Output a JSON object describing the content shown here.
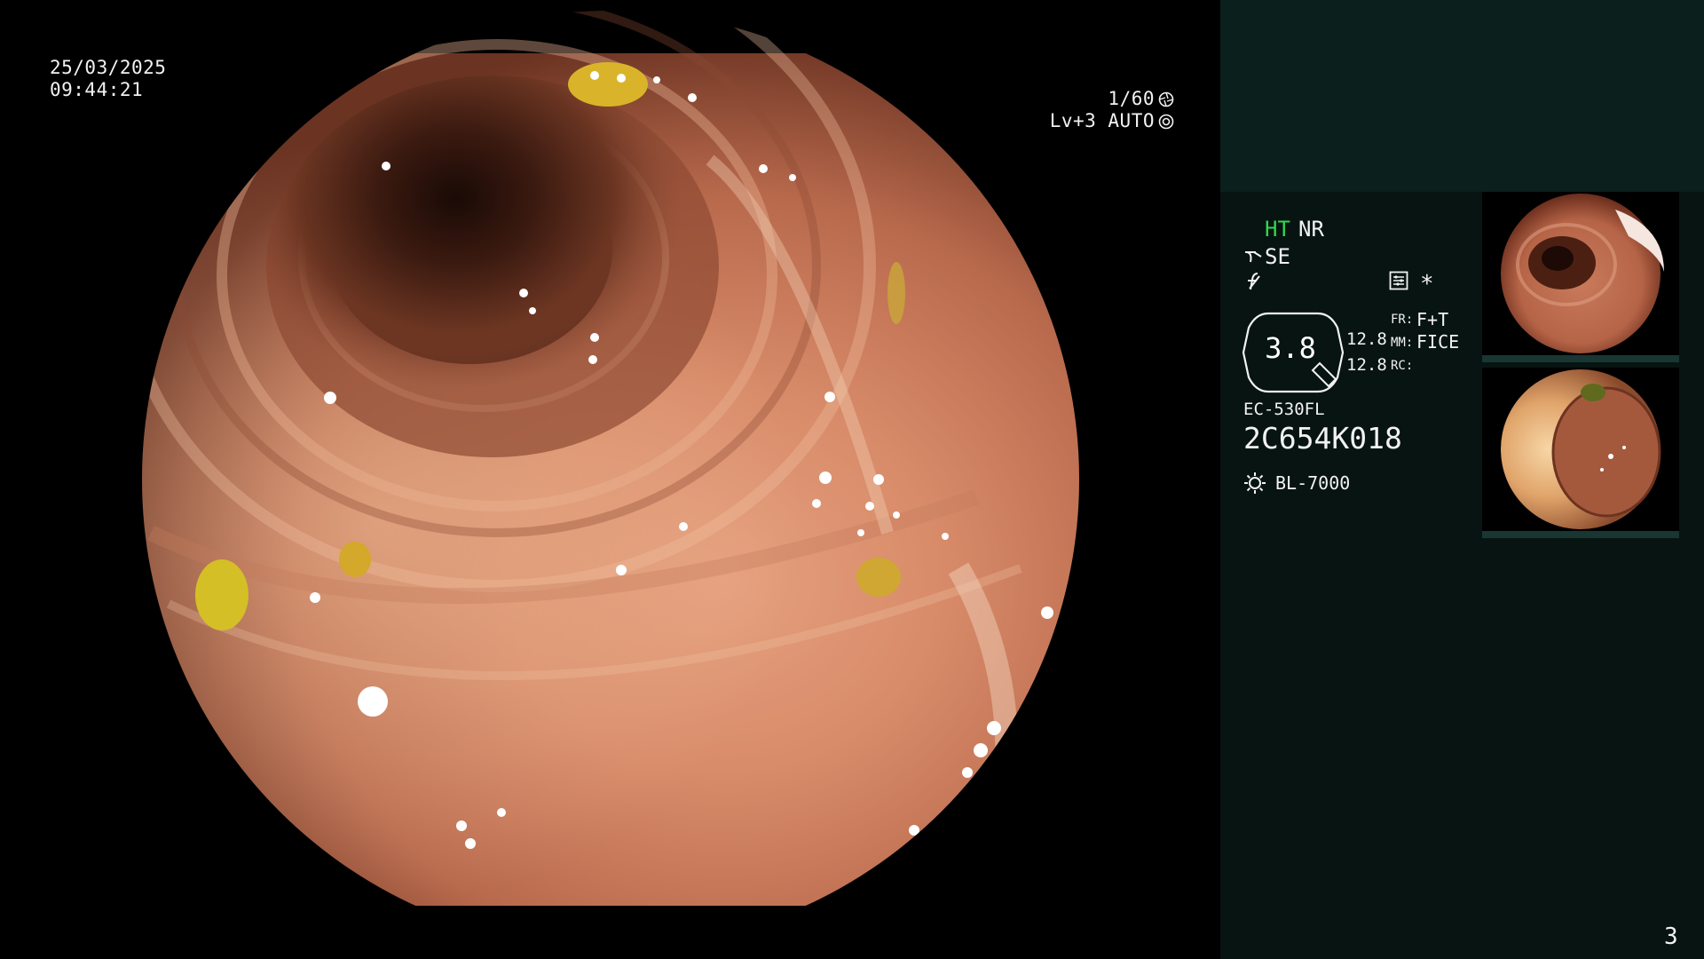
{
  "main_view": {
    "date": "25/03/2025",
    "time": "09:44:21",
    "shutter": "1/60",
    "level": "Lv+3 AUTO",
    "shutter_icon": "aperture-icon",
    "auto_icon": "iris-icon"
  },
  "side_panel": {
    "ht": "HT",
    "nr": "NR",
    "se": "SE",
    "zoom": "3.8",
    "value_1": "12.8",
    "value_2": "12.8",
    "fr_label": "FR:",
    "fr_value": "F+T",
    "mm_label": "MM:",
    "mm_value": "FICE",
    "rc_label": "RC:",
    "asterisk": "*",
    "scope_model": "EC-530FL",
    "scope_serial": "2C654K018",
    "light_source": "BL-7000",
    "page_number": "3"
  },
  "colors": {
    "ht_green": "#32d74b",
    "panel_bg": "#071412",
    "panel_top_bg": "#0b1f1d"
  }
}
